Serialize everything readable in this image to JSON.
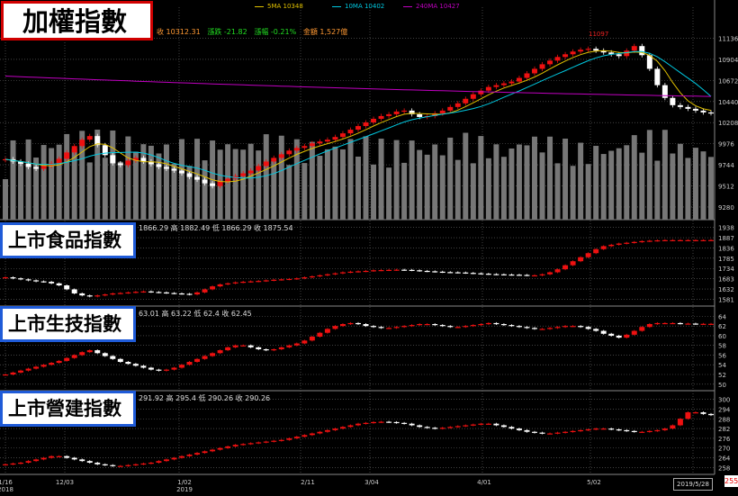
{
  "labels": {
    "main_title": "加權指數",
    "panel2_title": "上市食品指數",
    "panel3_title": "上市生技指數",
    "panel4_title": "上市營建指數"
  },
  "legend": {
    "ma5": "5MA 10348",
    "ma10": "10MA 10402",
    "ma240": "240MA 10427",
    "colors": {
      "ma5": "#e0c000",
      "ma10": "#00c8e0",
      "ma240": "#c000c0"
    }
  },
  "info": {
    "main": {
      "close": "收 10312.31",
      "change": "漲跌 -21.82",
      "pct": "漲幅 -0.21%",
      "amount": "金額 1,527億"
    },
    "food": "1866.29  高 1882.49  低 1866.29  收 1875.54",
    "bio": "63.01  高 63.22  低 62.4  收 62.45",
    "construction": "291.92  高 295.4  低 290.26  收 290.26"
  },
  "peak_label": "11097",
  "date_box": "2019/5/28",
  "corner_value": "255",
  "colors": {
    "up": "#ee1111",
    "down": "#ffffff",
    "volume": "#777777",
    "grid": "#6a6a6a",
    "axis_text": "#cccccc"
  },
  "chart_data": [
    {
      "type": "candlestick",
      "title": "加權指數",
      "yticks": [
        9280,
        9512,
        9744,
        9976,
        10208,
        10440,
        10672,
        10904,
        11136
      ],
      "ylim": [
        9180,
        11260
      ],
      "closes": [
        9805,
        9780,
        9755,
        9720,
        9700,
        9730,
        9760,
        9810,
        9880,
        9950,
        10020,
        10060,
        9960,
        9850,
        9760,
        9740,
        9790,
        9820,
        9780,
        9750,
        9720,
        9700,
        9680,
        9650,
        9610,
        9580,
        9540,
        9510,
        9560,
        9590,
        9620,
        9650,
        9680,
        9730,
        9780,
        9820,
        9860,
        9900,
        9930,
        9950,
        9980,
        10000,
        10020,
        10050,
        10090,
        10130,
        10170,
        10210,
        10250,
        10280,
        10300,
        10330,
        10340,
        10300,
        10270,
        10280,
        10310,
        10340,
        10380,
        10420,
        10470,
        10520,
        10560,
        10600,
        10620,
        10640,
        10660,
        10700,
        10750,
        10800,
        10850,
        10890,
        10930,
        10960,
        10990,
        11010,
        11020,
        11000,
        10980,
        10960,
        10940,
        11000,
        11050,
        10950,
        10800,
        10620,
        10480,
        10400,
        10380,
        10360,
        10340,
        10320,
        10312
      ],
      "xticks": [
        "1/16\n2018",
        "12/03",
        "1/02\n2019",
        "2/11",
        "3/04",
        "4/01",
        "5/02"
      ]
    },
    {
      "type": "candlestick",
      "title": "上市食品指數",
      "yticks": [
        1581,
        1632,
        1683,
        1734,
        1785,
        1836,
        1887,
        1938
      ],
      "ylim": [
        1565,
        1950
      ],
      "closes": [
        1690,
        1685,
        1680,
        1675,
        1670,
        1668,
        1660,
        1650,
        1630,
        1610,
        1600,
        1595,
        1600,
        1605,
        1610,
        1612,
        1615,
        1618,
        1620,
        1617,
        1615,
        1612,
        1610,
        1608,
        1605,
        1615,
        1630,
        1645,
        1655,
        1660,
        1665,
        1668,
        1670,
        1672,
        1675,
        1678,
        1680,
        1682,
        1685,
        1690,
        1695,
        1700,
        1705,
        1710,
        1715,
        1718,
        1720,
        1722,
        1725,
        1726,
        1727,
        1728,
        1727,
        1725,
        1722,
        1720,
        1718,
        1716,
        1715,
        1714,
        1712,
        1710,
        1708,
        1706,
        1705,
        1704,
        1703,
        1702,
        1700,
        1700,
        1705,
        1715,
        1730,
        1750,
        1770,
        1790,
        1810,
        1830,
        1845,
        1852,
        1858,
        1862,
        1866,
        1870,
        1872,
        1874,
        1875,
        1875,
        1875,
        1875,
        1875,
        1875,
        1875.54
      ]
    },
    {
      "type": "candlestick",
      "title": "上市生技指數",
      "yticks": [
        50,
        52,
        54,
        56,
        58,
        60,
        62,
        64
      ],
      "ylim": [
        49.4,
        65
      ],
      "closes": [
        52.0,
        52.4,
        52.8,
        53.2,
        53.6,
        54.0,
        54.4,
        54.8,
        55.4,
        56.0,
        56.6,
        57.0,
        56.4,
        55.8,
        55.2,
        54.6,
        54.2,
        53.8,
        53.4,
        53.0,
        52.8,
        53.0,
        53.4,
        54.0,
        54.6,
        55.2,
        55.8,
        56.4,
        57.0,
        57.6,
        58.0,
        58.0,
        57.6,
        57.2,
        57.0,
        57.2,
        57.6,
        58.0,
        58.4,
        59.0,
        59.8,
        60.6,
        61.4,
        62.0,
        62.4,
        62.6,
        62.4,
        62.0,
        61.8,
        61.6,
        61.6,
        61.8,
        62.0,
        62.2,
        62.4,
        62.4,
        62.2,
        62.0,
        61.8,
        61.8,
        62.0,
        62.2,
        62.4,
        62.6,
        62.4,
        62.2,
        62.0,
        61.8,
        61.6,
        61.4,
        61.4,
        61.6,
        61.8,
        62.0,
        62.0,
        61.8,
        61.4,
        61.0,
        60.4,
        60.0,
        59.6,
        60.2,
        61.0,
        61.8,
        62.4,
        62.6,
        62.6,
        62.6,
        62.5,
        62.5,
        62.45,
        62.45,
        62.45
      ]
    },
    {
      "type": "candlestick",
      "title": "上市營建指數",
      "yticks": [
        258,
        264,
        270,
        276,
        282,
        288,
        294,
        300
      ],
      "ylim": [
        256,
        302
      ],
      "closes": [
        260,
        260.5,
        261,
        262,
        263,
        264,
        265,
        265,
        264,
        263,
        262,
        261,
        260,
        259.5,
        259,
        259,
        259.5,
        260,
        260.5,
        261,
        262,
        263,
        264,
        265,
        266,
        267,
        268,
        269,
        270,
        271,
        272,
        272.5,
        273,
        273.5,
        274,
        274.5,
        275,
        276,
        277,
        278,
        279,
        280,
        281,
        282,
        283,
        284,
        285,
        285.5,
        286,
        286.2,
        286,
        285.5,
        285,
        284,
        283,
        282.5,
        282,
        282.5,
        283,
        283.5,
        284,
        284.5,
        285,
        285,
        284,
        283,
        282,
        281,
        280,
        279.5,
        279,
        279,
        279.5,
        280,
        280.5,
        281,
        281.5,
        282,
        282,
        281.5,
        281,
        280.5,
        280,
        280,
        280.5,
        281,
        282,
        284,
        288,
        292,
        292,
        291,
        290.26
      ]
    }
  ]
}
